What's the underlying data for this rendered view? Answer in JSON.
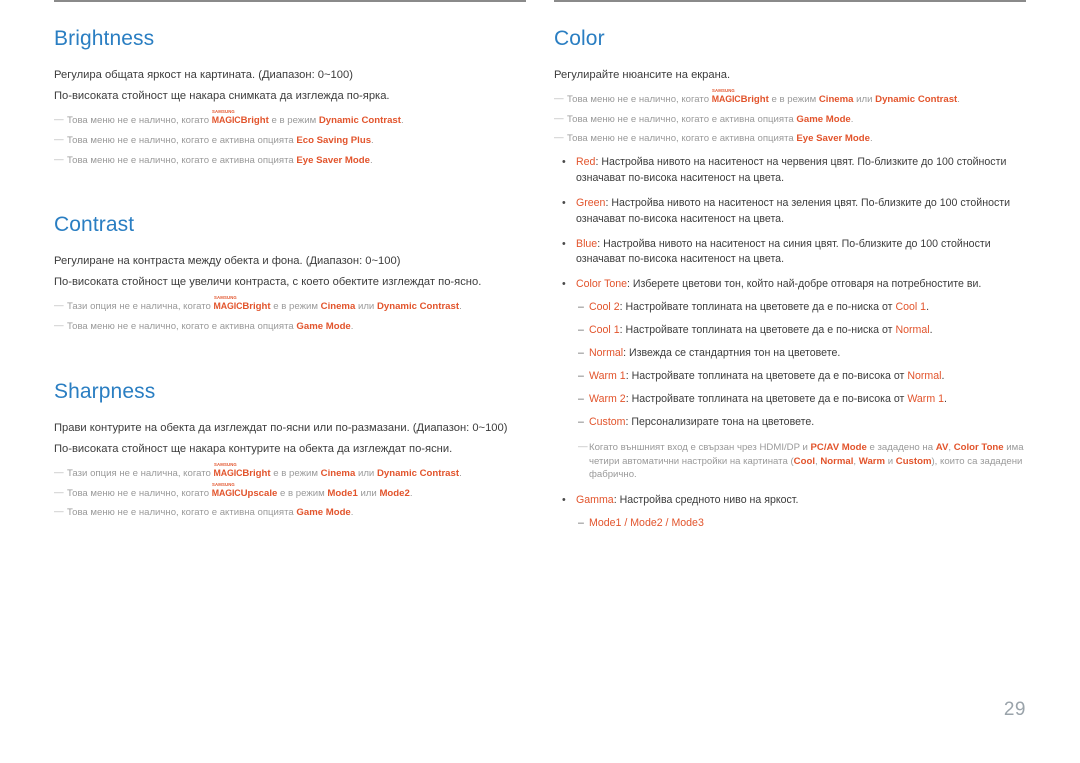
{
  "page": {
    "number": "29",
    "accent_blue": "#2a7ec2",
    "accent_orange": "#e2542c",
    "note_gray": "#9a9a9a",
    "rule_gray": "#8a8a8a"
  },
  "left_column": {
    "sections": [
      {
        "title": "Brightness",
        "intro": [
          "Регулира общата яркост на картината. (Диапазон: 0~100)",
          "По-високата стойност ще накара снимката да изглежда по-ярка."
        ],
        "notes": [
          {
            "pre": "Това меню не е налично, когато ",
            "logo": {
              "samsung": "SAMSUNG",
              "magic": "MAGIC",
              "suffix": "Bright"
            },
            "mid": " е в режим ",
            "kw1": "Dynamic Contrast",
            "post": "."
          },
          {
            "pre": "Това меню не е налично, когато е активна опцията ",
            "kw1": "Eco Saving Plus",
            "post": "."
          },
          {
            "pre": "Това меню не е налично, когато е активна опцията ",
            "kw1": "Eye Saver Mode",
            "post": "."
          }
        ]
      },
      {
        "title": "Contrast",
        "intro": [
          "Регулиране на контраста между обекта и фона. (Диапазон: 0~100)",
          "По-високата стойност ще увеличи контраста, с което обектите изглеждат по-ясно."
        ],
        "notes": [
          {
            "pre": "Тази опция не е налична, когато ",
            "logo": {
              "samsung": "SAMSUNG",
              "magic": "MAGIC",
              "suffix": "Bright"
            },
            "mid": " е в режим ",
            "kw1": "Cinema",
            "conj": " или ",
            "kw2": "Dynamic Contrast",
            "post": "."
          },
          {
            "pre": "Това меню не е налично, когато е активна опцията ",
            "kw1": "Game Mode",
            "post": "."
          }
        ]
      },
      {
        "title": "Sharpness",
        "intro": [
          "Прави контурите на обекта да изглеждат по-ясни или по-размазани. (Диапазон: 0~100)",
          "По-високата стойност ще накара контурите на обекта да изглеждат по-ясни."
        ],
        "notes": [
          {
            "pre": "Тази опция не е налична, когато ",
            "logo": {
              "samsung": "SAMSUNG",
              "magic": "MAGIC",
              "suffix": "Bright"
            },
            "mid": " е в режим ",
            "kw1": "Cinema",
            "conj": " или ",
            "kw2": "Dynamic Contrast",
            "post": "."
          },
          {
            "pre": "Това меню не е налично, когато ",
            "logo": {
              "samsung": "SAMSUNG",
              "magic": "MAGIC",
              "suffix": "Upscale"
            },
            "mid": " е в режим ",
            "kw1": "Mode1",
            "conj": " или ",
            "kw2": "Mode2",
            "post": "."
          },
          {
            "pre": "Това меню не е налично, когато е активна опцията ",
            "kw1": "Game Mode",
            "post": "."
          }
        ]
      }
    ]
  },
  "right_column": {
    "section": {
      "title": "Color",
      "intro": "Регулирайте нюансите на екрана.",
      "notes": [
        {
          "pre": "Това меню не е налично, когато ",
          "logo": {
            "samsung": "SAMSUNG",
            "magic": "MAGIC",
            "suffix": "Bright"
          },
          "mid": " е в режим ",
          "kw1": "Cinema",
          "conj": " или ",
          "kw2": "Dynamic Contrast",
          "post": "."
        },
        {
          "pre": "Това меню не е налично, когато е активна опцията ",
          "kw1": "Game Mode",
          "post": "."
        },
        {
          "pre": "Това меню не е налично, когато е активна опцията ",
          "kw1": "Eye Saver Mode",
          "post": "."
        }
      ],
      "bullets": [
        {
          "term": "Red",
          "text": ": Настройва нивото на наситеност на червения цвят. По-близките до 100 стойности означават по-висока наситеност на цвета."
        },
        {
          "term": "Green",
          "text": ": Настройва нивото на наситеност на зеления цвят. По-близките до 100 стойности означават по-висока наситеност на цвета."
        },
        {
          "term": "Blue",
          "text": ": Настройва нивото на наситеност на синия цвят. По-близките до 100 стойности означават по-висока наситеност на цвета."
        },
        {
          "term": "Color Tone",
          "text": ": Изберете цветови тон, който най-добре отговаря на потребностите ви."
        }
      ],
      "color_tone_options": [
        {
          "term": "Cool 2",
          "mid": ": Настройвате топлината на цветовете да е по-ниска от ",
          "ref": "Cool 1",
          "post": "."
        },
        {
          "term": "Cool 1",
          "mid": ": Настройвате топлината на цветовете да е по-ниска от ",
          "ref": "Normal",
          "post": "."
        },
        {
          "term": "Normal",
          "mid": ": Извежда се стандартния тон на цветовете.",
          "ref": "",
          "post": ""
        },
        {
          "term": "Warm 1",
          "mid": ": Настройвате топлината на цветовете да е по-висока от ",
          "ref": "Normal",
          "post": "."
        },
        {
          "term": "Warm 2",
          "mid": ": Настройвате топлината на цветовете да е по-висока от ",
          "ref": "Warm 1",
          "post": "."
        },
        {
          "term": "Custom",
          "mid": ": Персонализирате тона на цветовете.",
          "ref": "",
          "post": ""
        }
      ],
      "hdmi_note": {
        "p1": "Когато външният вход е свързан чрез HDMI/DP и ",
        "k1": "PC/AV Mode",
        "p2": " е зададено на ",
        "k2": "AV",
        "p3": ", ",
        "k3": "Color Tone",
        "p4": " има четири автоматични настройки на картината (",
        "k4": "Cool",
        "p5": ", ",
        "k5": "Normal",
        "p6": ", ",
        "k6": "Warm",
        "p7": " и ",
        "k7": "Custom",
        "p8": "), които са зададени фабрично."
      },
      "gamma": {
        "term": "Gamma",
        "text": ": Настройва средното ниво на яркост.",
        "modes": "Mode1 / Mode2 / Mode3"
      }
    }
  },
  "icons": {
    "note_dash": "—",
    "bullet_dot": "•",
    "sub_dash": "–"
  }
}
